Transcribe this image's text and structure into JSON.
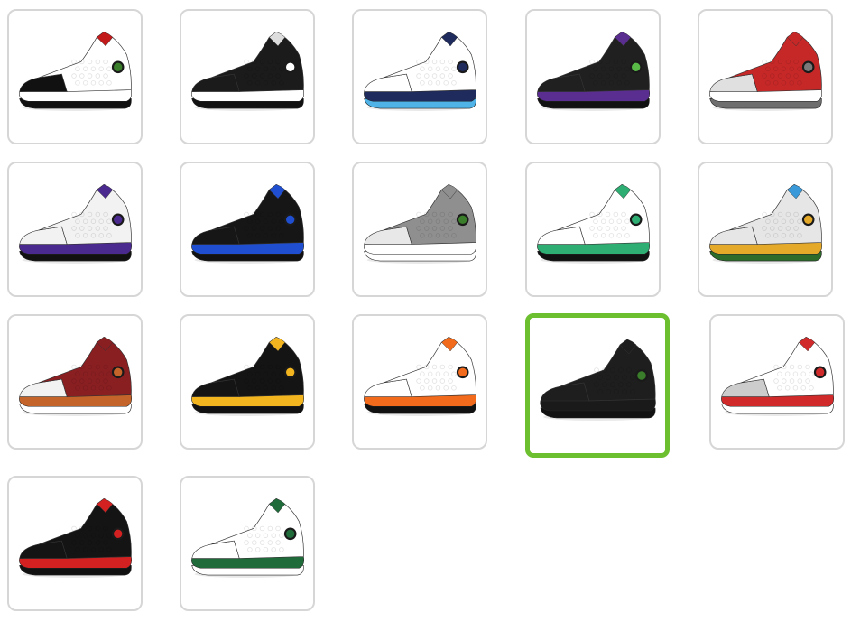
{
  "gallery": {
    "selected_index": 13,
    "items": [
      {
        "colorway": "he-got-game",
        "upper": "#ffffff",
        "toe": "#111111",
        "midsole": "#ffffff",
        "outsole": "#111111",
        "eye": "#3a7d2a",
        "accent": "#c21a1a"
      },
      {
        "colorway": "reverse-he-got-game",
        "upper": "#1b1b1b",
        "toe": "#1b1b1b",
        "midsole": "#ffffff",
        "outsole": "#111111",
        "eye": "#ffffff",
        "accent": "#dddddd"
      },
      {
        "colorway": "obsidian",
        "upper": "#ffffff",
        "toe": "#ffffff",
        "midsole": "#1f2b5c",
        "outsole": "#4fb3e8",
        "eye": "#1f2b5c",
        "accent": "#1f2b5c"
      },
      {
        "colorway": "court-purple",
        "upper": "#202020",
        "toe": "#202020",
        "midsole": "#5a2d91",
        "outsole": "#111111",
        "eye": "#58b947",
        "accent": "#5a2d91"
      },
      {
        "colorway": "gym-red",
        "upper": "#c62828",
        "toe": "#e0e0e0",
        "midsole": "#ffffff",
        "outsole": "#6e6e6e",
        "eye": "#7a7a7a",
        "accent": "#c62828"
      },
      {
        "colorway": "lakers",
        "upper": "#f2f2f2",
        "toe": "#f2f2f2",
        "midsole": "#4b2a8f",
        "outsole": "#111111",
        "eye": "#4b2a8f",
        "accent": "#4b2a8f"
      },
      {
        "colorway": "hyper-royal",
        "upper": "#161616",
        "toe": "#161616",
        "midsole": "#1f4fd0",
        "outsole": "#111111",
        "eye": "#1f4fd0",
        "accent": "#1f4fd0"
      },
      {
        "colorway": "atmosphere-grey",
        "upper": "#8f8f8f",
        "toe": "#e8e8e8",
        "midsole": "#ffffff",
        "outsole": "#ffffff",
        "eye": "#3a7d2a",
        "accent": "#8f8f8f"
      },
      {
        "colorway": "lucky-green",
        "upper": "#ffffff",
        "toe": "#ffffff",
        "midsole": "#2eae73",
        "outsole": "#111111",
        "eye": "#2eae73",
        "accent": "#2eae73"
      },
      {
        "colorway": "playground",
        "upper": "#e6e6e6",
        "toe": "#e6e6e6",
        "midsole": "#e5a92a",
        "outsole": "#2d6b2a",
        "eye": "#e5a92a",
        "accent": "#3a9ad9"
      },
      {
        "colorway": "dune-red",
        "upper": "#8a1f22",
        "toe": "#f2f2f2",
        "midsole": "#c5642a",
        "outsole": "#ffffff",
        "eye": "#c5642a",
        "accent": "#8a1f22"
      },
      {
        "colorway": "del-sol",
        "upper": "#141414",
        "toe": "#141414",
        "midsole": "#f2b51f",
        "outsole": "#111111",
        "eye": "#f2b51f",
        "accent": "#f2b51f"
      },
      {
        "colorway": "starfish",
        "upper": "#ffffff",
        "toe": "#ffffff",
        "midsole": "#f26b1d",
        "outsole": "#111111",
        "eye": "#f26b1d",
        "accent": "#f26b1d"
      },
      {
        "colorway": "black-cat",
        "upper": "#1e1e1e",
        "toe": "#1e1e1e",
        "midsole": "#1a1a1a",
        "outsole": "#111111",
        "eye": "#3a7d2a",
        "accent": "#1e1e1e"
      },
      {
        "colorway": "grey-toe",
        "upper": "#ffffff",
        "toe": "#cccccc",
        "midsole": "#d12a2a",
        "outsole": "#ffffff",
        "eye": "#d12a2a",
        "accent": "#d12a2a"
      },
      {
        "colorway": "bred",
        "upper": "#141414",
        "toe": "#141414",
        "midsole": "#d32020",
        "outsole": "#111111",
        "eye": "#d32020",
        "accent": "#d32020"
      },
      {
        "colorway": "pine-green",
        "upper": "#ffffff",
        "toe": "#ffffff",
        "midsole": "#1f6b3a",
        "outsole": "#ffffff",
        "eye": "#1f6b3a",
        "accent": "#1f6b3a"
      }
    ]
  }
}
